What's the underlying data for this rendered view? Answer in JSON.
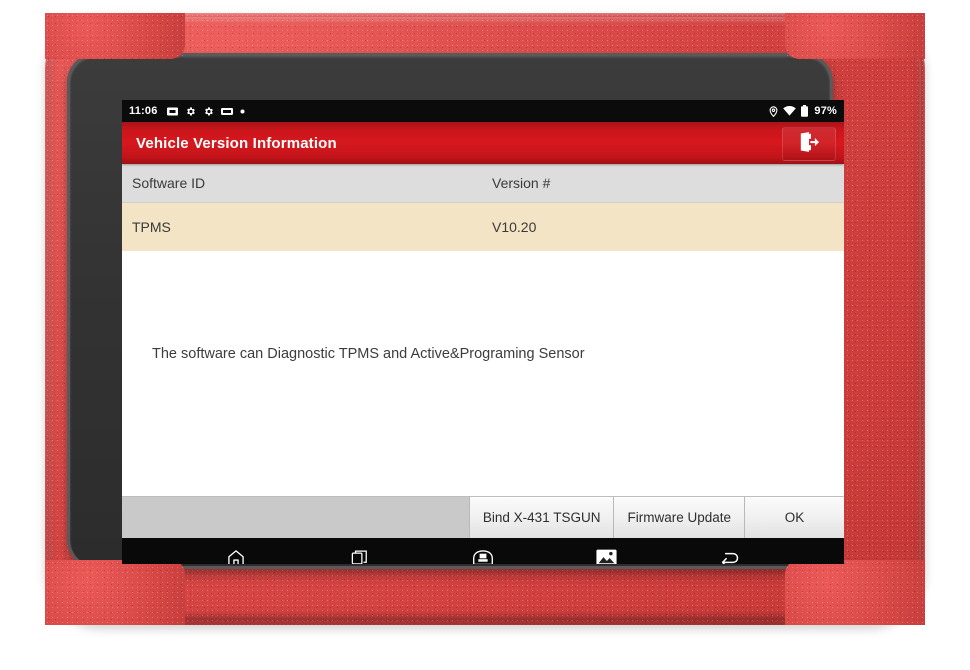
{
  "device": {
    "frame_color": "#d94a48",
    "bezel_color": "#343434"
  },
  "statusbar": {
    "time": "11:06",
    "battery_percent": "97%",
    "left_icons": [
      "sdcard-icon",
      "gear-icon",
      "gear-icon",
      "vci-icon",
      "dot-icon"
    ],
    "right_icons": [
      "location-icon",
      "wifi-icon",
      "battery-icon"
    ]
  },
  "titlebar": {
    "title": "Vehicle Version Information",
    "exit_icon": "exit-icon",
    "background_color": "#d6181e"
  },
  "table": {
    "headers": [
      "Software ID",
      "Version #"
    ],
    "rows": [
      {
        "software_id": "TPMS",
        "version": "V10.20"
      }
    ],
    "header_bg": "#dddddd",
    "row_bg": "#f2e4c4"
  },
  "body": {
    "description": "The software can Diagnostic TPMS and Active&Programing Sensor"
  },
  "toolbar": {
    "buttons": [
      {
        "label": "Bind X-431 TSGUN"
      },
      {
        "label": "Firmware Update"
      },
      {
        "label": "OK"
      }
    ],
    "background_color": "#c9c9c9"
  },
  "navbar": {
    "items": [
      {
        "icon": "home-icon"
      },
      {
        "icon": "recent-apps-icon"
      },
      {
        "icon": "vci-connector-icon"
      },
      {
        "icon": "screenshot-icon"
      },
      {
        "icon": "back-icon"
      }
    ]
  }
}
